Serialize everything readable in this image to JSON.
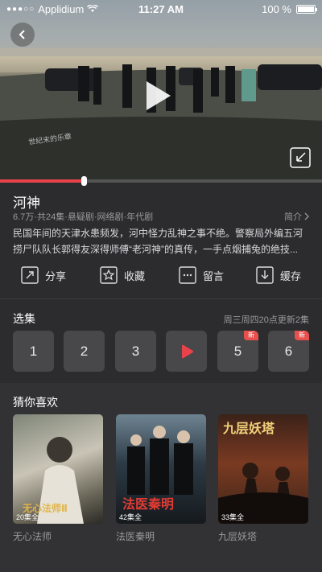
{
  "status_bar": {
    "carrier": "Applidium",
    "time": "11:27 AM",
    "battery": "100 %",
    "battery_level": 1.0
  },
  "player": {
    "watermark": "世纪末的乐章",
    "progress": 0.26
  },
  "show": {
    "title": "河神",
    "meta": "6.7万·共24集·悬疑剧·网络剧·年代剧",
    "intro_label": "简介",
    "description": "民国年间的天津水患频发，河中怪力乱神之事不绝。警察局外编五河捞尸队队长郭得友深得师傅“老河神”的真传，一手点烟捕兔的绝技..."
  },
  "actions": [
    {
      "label": "分享",
      "icon": "share-icon"
    },
    {
      "label": "收藏",
      "icon": "favorite-icon"
    },
    {
      "label": "留言",
      "icon": "comment-icon"
    },
    {
      "label": "缓存",
      "icon": "download-icon"
    }
  ],
  "episodes": {
    "section_title": "选集",
    "update_note": "周三周四20点更新2集",
    "items": [
      {
        "label": "1"
      },
      {
        "label": "2"
      },
      {
        "label": "3"
      },
      {
        "label": "",
        "playing": true
      },
      {
        "label": "5",
        "badge": "新"
      },
      {
        "label": "6",
        "badge": "新"
      }
    ]
  },
  "recommend": {
    "section_title": "猜你喜欢",
    "items": [
      {
        "name": "无心法师",
        "poster_text": "无心法师Ⅱ",
        "count": "20集全"
      },
      {
        "name": "法医秦明",
        "poster_text": "法医秦明",
        "count": "42集全"
      },
      {
        "name": "九层妖塔",
        "poster_text": "九层妖塔",
        "count": "33集全"
      }
    ]
  },
  "colors": {
    "accent": "#e8424a",
    "background": "#2c2b2e",
    "tile": "#48474a"
  }
}
